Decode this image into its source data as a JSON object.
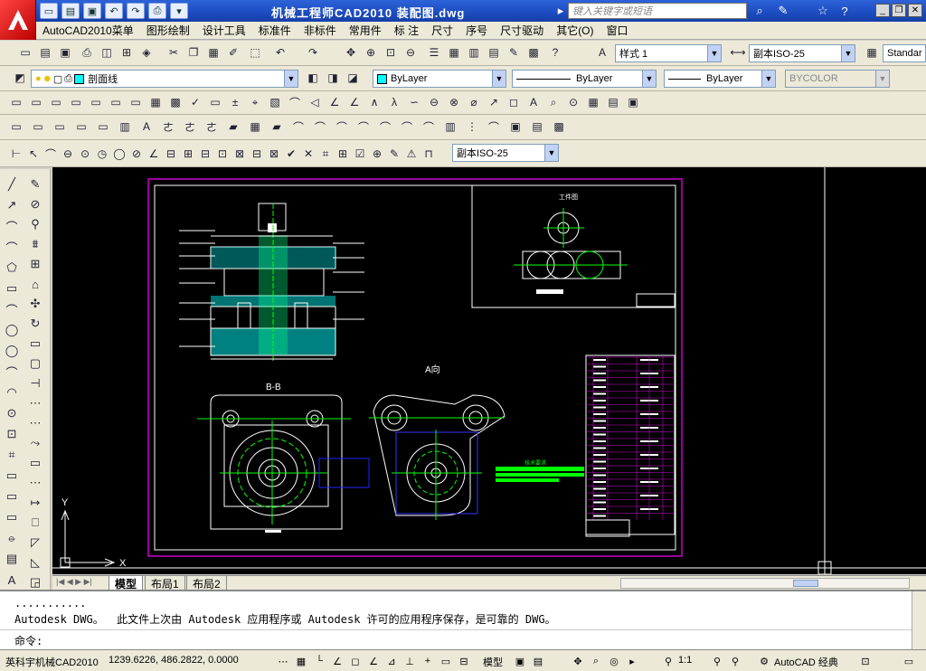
{
  "window": {
    "title": "机械工程师CAD2010   装配图.dwg",
    "search_placeholder": "键入关键字或短语"
  },
  "menu": [
    "AutoCAD2010菜单",
    "图形绘制",
    "设计工具",
    "标准件",
    "非标件",
    "常用件",
    "标 注",
    "尺寸",
    "序号",
    "尺寸驱动",
    "其它(O)",
    "窗口"
  ],
  "toolbar": {
    "text_style": "样式 1",
    "dim_style": "副本ISO-25",
    "table_style": "Standar",
    "layer": "剖面线",
    "color": "ByLayer",
    "linetype": "ByLayer",
    "lineweight": "ByLayer",
    "plotstyle": "BYCOLOR",
    "dim_style2": "副本ISO-25"
  },
  "drawing": {
    "section_label": "B-B",
    "view_label": "A向",
    "workpiece_label": "工件图",
    "tech_req": "技术要求",
    "ucs_x": "X",
    "ucs_y": "Y"
  },
  "tabs": [
    "模型",
    "布局1",
    "布局2"
  ],
  "command": {
    "line1": "...........",
    "line2": "Autodesk DWG。  此文件上次由 Autodesk 应用程序或 Autodesk 许可的应用程序保存，是可靠的 DWG。",
    "prompt": "命令:"
  },
  "status": {
    "app": "英科宇机械CAD2010",
    "coords": "1239.6226, 486.2822, 0.0000",
    "model": "模型",
    "scale": "1:1",
    "workspace": "AutoCAD 经典"
  },
  "colors": {
    "accent": "#1c4cc0",
    "canvas": "#000000",
    "frame": "#cc00cc"
  }
}
